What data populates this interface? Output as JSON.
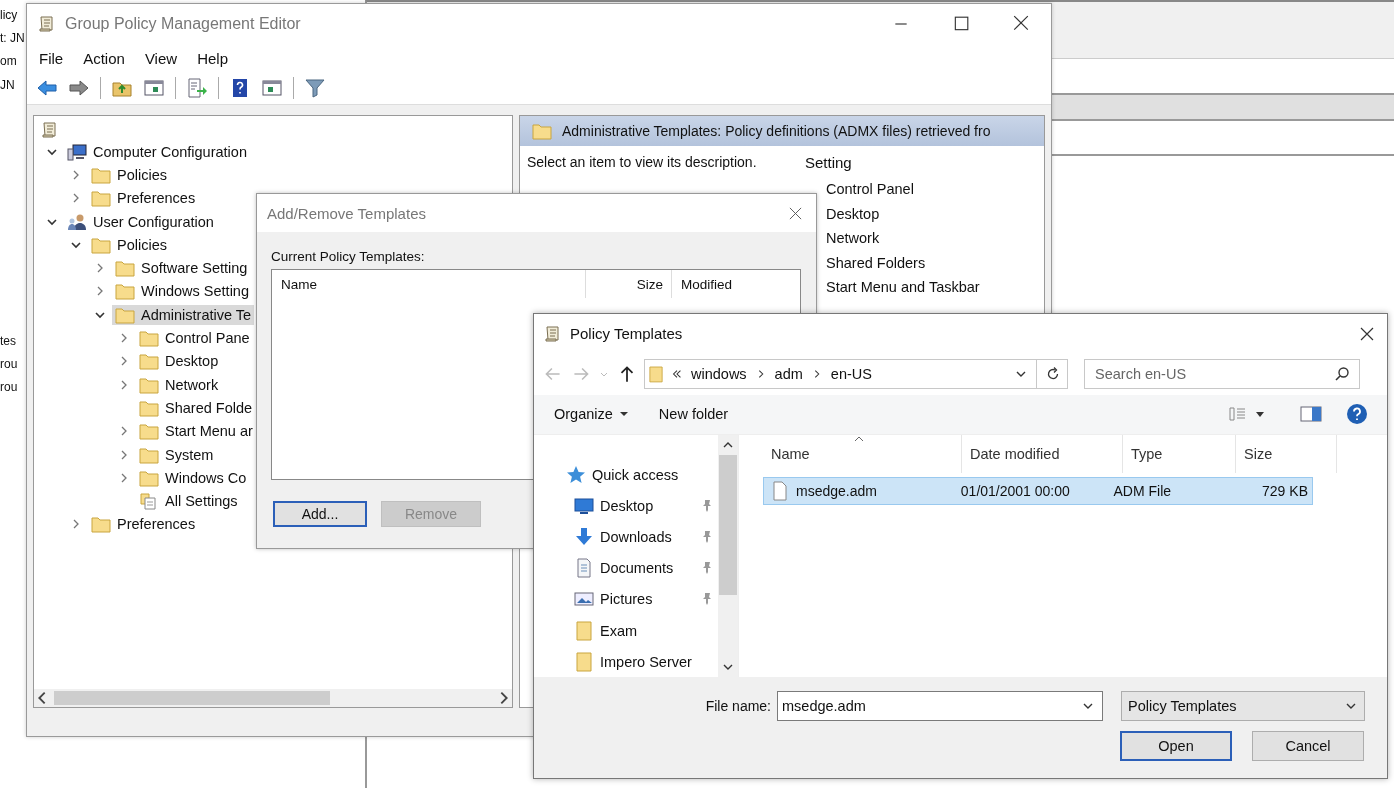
{
  "background": {
    "edge_texts": [
      "licy",
      "t: JN",
      "om",
      "JN",
      "tes",
      "rou",
      "rou"
    ]
  },
  "editor": {
    "title": "Group Policy Management Editor",
    "menu": [
      "File",
      "Action",
      "View",
      "Help"
    ],
    "tree": [
      {
        "label": "Computer Configuration",
        "kind": "computer",
        "expandable": true,
        "expanded": true,
        "selected": false,
        "children": [
          {
            "label": "Policies",
            "kind": "folder",
            "expandable": true,
            "expanded": false,
            "selected": false
          },
          {
            "label": "Preferences",
            "kind": "folder",
            "expandable": true,
            "expanded": false,
            "selected": false
          }
        ]
      },
      {
        "label": "User Configuration",
        "kind": "user",
        "expandable": true,
        "expanded": true,
        "selected": false,
        "children": [
          {
            "label": "Policies",
            "kind": "folder",
            "expandable": true,
            "expanded": true,
            "selected": false,
            "children": [
              {
                "label": "Software Setting",
                "kind": "folder",
                "expandable": true,
                "expanded": false,
                "selected": false
              },
              {
                "label": "Windows Setting",
                "kind": "folder",
                "expandable": true,
                "expanded": false,
                "selected": false
              },
              {
                "label": "Administrative Te",
                "kind": "folder",
                "expandable": true,
                "expanded": true,
                "selected": true,
                "children": [
                  {
                    "label": "Control Pane",
                    "kind": "folder",
                    "expandable": true,
                    "expanded": false,
                    "selected": false
                  },
                  {
                    "label": "Desktop",
                    "kind": "folder",
                    "expandable": true,
                    "expanded": false,
                    "selected": false
                  },
                  {
                    "label": "Network",
                    "kind": "folder",
                    "expandable": true,
                    "expanded": false,
                    "selected": false
                  },
                  {
                    "label": "Shared Folde",
                    "kind": "folder",
                    "expandable": false,
                    "selected": false
                  },
                  {
                    "label": "Start Menu ar",
                    "kind": "folder",
                    "expandable": true,
                    "expanded": false,
                    "selected": false
                  },
                  {
                    "label": "System",
                    "kind": "folder",
                    "expandable": true,
                    "expanded": false,
                    "selected": false
                  },
                  {
                    "label": "Windows Co",
                    "kind": "folder",
                    "expandable": true,
                    "expanded": false,
                    "selected": false
                  },
                  {
                    "label": "All Settings",
                    "kind": "settings",
                    "expandable": false,
                    "selected": false
                  }
                ]
              }
            ]
          },
          {
            "label": "Preferences",
            "kind": "folder",
            "expandable": true,
            "expanded": false,
            "selected": false
          }
        ]
      }
    ],
    "pane_header": "Administrative Templates: Policy definitions (ADMX files) retrieved fro",
    "description": "Select an item to view its description.",
    "column": "Setting",
    "settings": [
      "Control Panel",
      "Desktop",
      "Network",
      "Shared Folders",
      "Start Menu and Taskbar"
    ]
  },
  "add_remove": {
    "title": "Add/Remove Templates",
    "list_label": "Current Policy Templates:",
    "columns": [
      "Name",
      "Size",
      "Modified"
    ],
    "buttons": [
      {
        "label": "Add...",
        "default": true,
        "disabled": false
      },
      {
        "label": "Remove",
        "default": false,
        "disabled": true
      }
    ]
  },
  "file_dialog": {
    "title": "Policy Templates",
    "path": [
      "windows",
      "adm",
      "en-US"
    ],
    "search": {
      "placeholder": "Search en-US"
    },
    "organize": "Organize",
    "new_folder": "New folder",
    "nav": [
      {
        "label": "Quick access",
        "kind": "star",
        "pinned": false
      },
      {
        "label": "Desktop",
        "kind": "desktop",
        "pinned": true
      },
      {
        "label": "Downloads",
        "kind": "download",
        "pinned": true
      },
      {
        "label": "Documents",
        "kind": "document",
        "pinned": true
      },
      {
        "label": "Pictures",
        "kind": "pictures",
        "pinned": true
      },
      {
        "label": "Exam",
        "kind": "folder",
        "pinned": false
      },
      {
        "label": "Impero Server",
        "kind": "folder",
        "pinned": false
      }
    ],
    "columns": [
      "Name",
      "Date modified",
      "Type",
      "Size"
    ],
    "files": [
      {
        "name": "msedge.adm",
        "modified": "01/01/2001 00:00",
        "type": "ADM File",
        "size": "729 KB",
        "selected": true
      }
    ],
    "file_name_label": "File name:",
    "file_name": "msedge.adm",
    "filter": "Policy Templates",
    "buttons": [
      {
        "label": "Open",
        "default": true
      },
      {
        "label": "Cancel",
        "default": false
      }
    ]
  }
}
